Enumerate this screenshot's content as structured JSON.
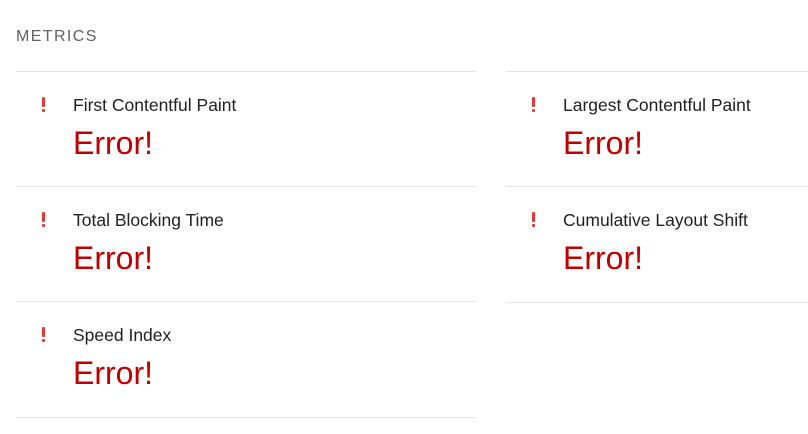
{
  "section": {
    "title": "METRICS"
  },
  "metrics": [
    {
      "title": "First Contentful Paint",
      "value": "Error!",
      "status": "error",
      "icon": "alert-icon"
    },
    {
      "title": "Largest Contentful Paint",
      "value": "Error!",
      "status": "error",
      "icon": "alert-icon"
    },
    {
      "title": "Total Blocking Time",
      "value": "Error!",
      "status": "error",
      "icon": "alert-icon"
    },
    {
      "title": "Cumulative Layout Shift",
      "value": "Error!",
      "status": "error",
      "icon": "alert-icon"
    },
    {
      "title": "Speed Index",
      "value": "Error!",
      "status": "error",
      "icon": "alert-icon"
    }
  ],
  "colors": {
    "error": "#c00000",
    "alert_icon": "#e53935",
    "header": "#616161",
    "divider": "#e3e3e3"
  }
}
